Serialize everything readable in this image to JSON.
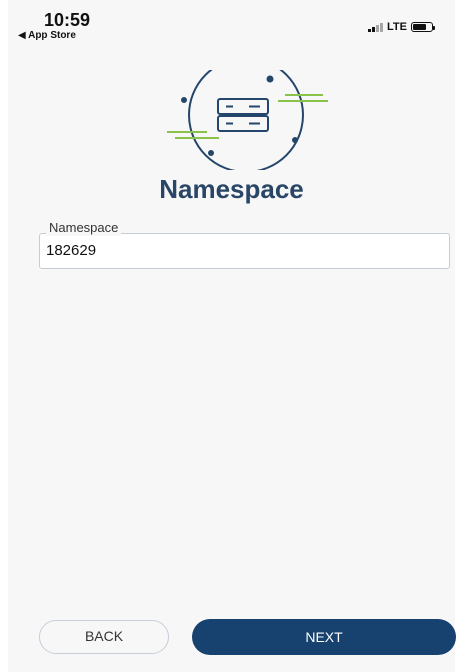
{
  "status_bar": {
    "time": "10:59",
    "back_label": "◀ App Store",
    "network": "LTE"
  },
  "icons": {
    "logo": "server-stack-icon",
    "signal": "cellular-signal-icon",
    "battery": "battery-icon"
  },
  "page": {
    "title": "Namespace"
  },
  "namespace_field": {
    "label": "Namespace",
    "value": "182629"
  },
  "buttons": {
    "back": "BACK",
    "next": "NEXT"
  },
  "colors": {
    "primary": "#17416e",
    "title": "#2a4667",
    "accent_green": "#8bc34a",
    "background": "#f7f7f8"
  }
}
